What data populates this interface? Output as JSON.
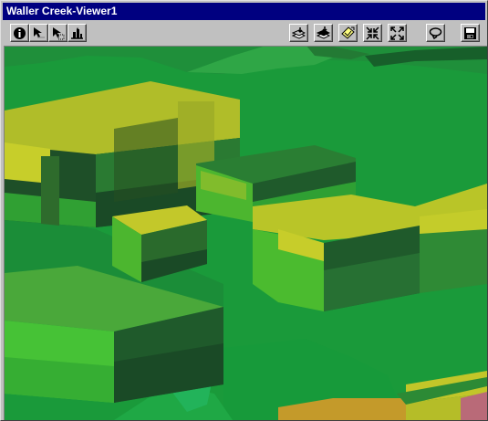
{
  "window": {
    "title": "Waller Creek-Viewer1"
  },
  "toolbar": {
    "left_tools": [
      {
        "name": "info-tool",
        "icon": "info-icon"
      },
      {
        "name": "select-tool",
        "icon": "select-arrow-icon"
      },
      {
        "name": "select-multiple-tool",
        "icon": "select-multiple-icon"
      },
      {
        "name": "navigate-tool",
        "icon": "navigate-icon"
      }
    ],
    "right_tools": [
      {
        "name": "zoom-to-themes",
        "icon": "layers-zoom-icon"
      },
      {
        "name": "zoom-to-active-themes",
        "icon": "active-layers-zoom-icon"
      },
      {
        "name": "zoom-to-selected",
        "icon": "selected-zoom-icon"
      },
      {
        "name": "zoom-in",
        "icon": "zoom-in-arrows-icon"
      },
      {
        "name": "zoom-out",
        "icon": "zoom-out-arrows-icon"
      },
      {
        "name": "rotate-view",
        "icon": "rotate-icon"
      },
      {
        "name": "save-view",
        "icon": "save-icon"
      }
    ]
  },
  "scene": {
    "description_colors": {
      "terrain": "#1a9a3a",
      "building_top": "#b5c229",
      "building_mid": "#4cb82f",
      "building_dark": "#1e5a2a",
      "building_low": "#30a830",
      "orange_roof": "#c49a2a",
      "pink_roof": "#b96a78"
    }
  }
}
